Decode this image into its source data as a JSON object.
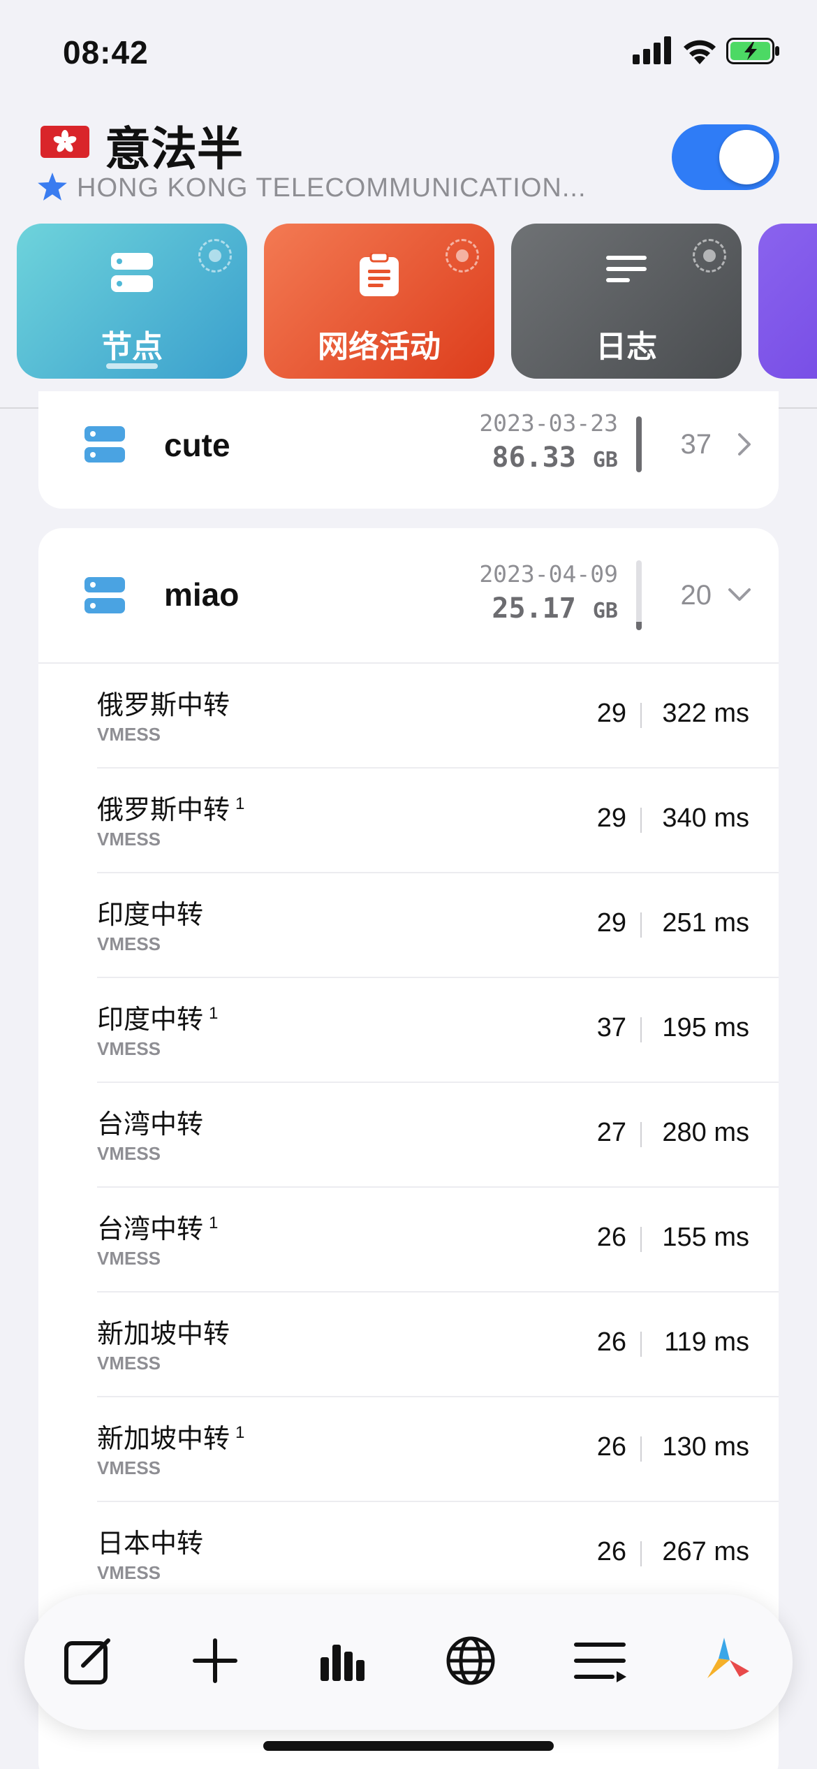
{
  "status": {
    "time": "08:42"
  },
  "header": {
    "title": "意法半",
    "subtitle": "HONG KONG TELECOMMUNICATION...",
    "toggle_on": true
  },
  "tiles": [
    {
      "label": "节点",
      "icon": "server-icon",
      "color": "#4fb8d6"
    },
    {
      "label": "网络活动",
      "icon": "clipboard-icon",
      "color": "#e8532c"
    },
    {
      "label": "日志",
      "icon": "lines-icon",
      "color": "#5b5e61"
    },
    {
      "label": "",
      "icon": "more-tile",
      "color": "#7a4fe8"
    }
  ],
  "groups": [
    {
      "name": "cute",
      "date": "2023-03-23",
      "size": "86.33",
      "unit": "GB",
      "count": "37"
    },
    {
      "name": "miao",
      "date": "2023-04-09",
      "size": "25.17",
      "unit": "GB",
      "count": "20"
    }
  ],
  "nodes": [
    {
      "name": "俄罗斯中转",
      "sup": "",
      "type": "VMESS",
      "score": "29",
      "latency": "322 ms"
    },
    {
      "name": "俄罗斯中转",
      "sup": "1",
      "type": "VMESS",
      "score": "29",
      "latency": "340 ms"
    },
    {
      "name": "印度中转",
      "sup": "",
      "type": "VMESS",
      "score": "29",
      "latency": "251 ms"
    },
    {
      "name": "印度中转",
      "sup": "1",
      "type": "VMESS",
      "score": "37",
      "latency": "195 ms"
    },
    {
      "name": "台湾中转",
      "sup": "",
      "type": "VMESS",
      "score": "27",
      "latency": "280 ms"
    },
    {
      "name": "台湾中转",
      "sup": "1",
      "type": "VMESS",
      "score": "26",
      "latency": "155 ms"
    },
    {
      "name": "新加坡中转",
      "sup": "",
      "type": "VMESS",
      "score": "26",
      "latency": "119 ms"
    },
    {
      "name": "新加坡中转",
      "sup": "1",
      "type": "VMESS",
      "score": "26",
      "latency": "130 ms"
    },
    {
      "name": "日本中转",
      "sup": "",
      "type": "VMESS",
      "score": "26",
      "latency": "267 ms"
    }
  ],
  "tabbar": [
    "edit-icon",
    "plus-icon",
    "chart-icon",
    "globe-icon",
    "playlist-icon",
    "app-logo-icon"
  ]
}
